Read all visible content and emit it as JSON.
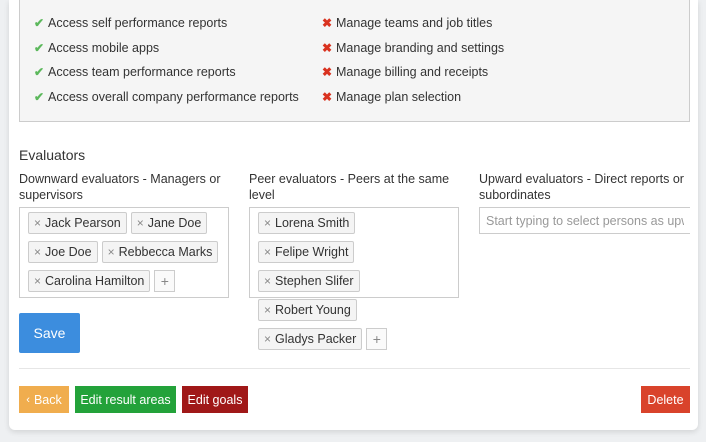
{
  "permissions": {
    "allowed": [
      "Access self performance reports",
      "Access mobile apps",
      "Access team performance reports",
      "Access overall company performance reports"
    ],
    "denied": [
      "Manage teams and job titles",
      "Manage branding and settings",
      "Manage billing and receipts",
      "Manage plan selection"
    ],
    "allowed_icon": "check-icon",
    "denied_icon": "cross-icon",
    "allowed_color": "#5cb85c",
    "denied_color": "#d9321f"
  },
  "evaluators": {
    "title": "Evaluators",
    "downward": {
      "label": "Downward evaluators - Managers or supervisors",
      "tags": [
        "Jack Pearson",
        "Jane Doe",
        "Joe Doe",
        "Rebbecca Marks",
        "Carolina Hamilton"
      ]
    },
    "peer": {
      "label": "Peer evaluators - Peers at the same level",
      "tags": [
        "Lorena Smith",
        "Felipe Wright",
        "Stephen Slifer",
        "Robert Young",
        "Gladys Packer"
      ]
    },
    "upward": {
      "label": "Upward evaluators - Direct reports or subordinates",
      "placeholder": "Start typing to select persons as upward evaluators"
    },
    "remove_symbol": "×",
    "add_symbol": "+"
  },
  "actions": {
    "save": "Save",
    "back": "Back",
    "back_icon": "chevron-left-icon",
    "edit_result_areas": "Edit result areas",
    "edit_goals": "Edit goals",
    "delete": "Delete"
  },
  "colors": {
    "save": "#3c8dde",
    "back": "#f0ad4e",
    "edit_result_areas": "#23a23a",
    "edit_goals": "#a01818",
    "delete": "#d9432b"
  }
}
